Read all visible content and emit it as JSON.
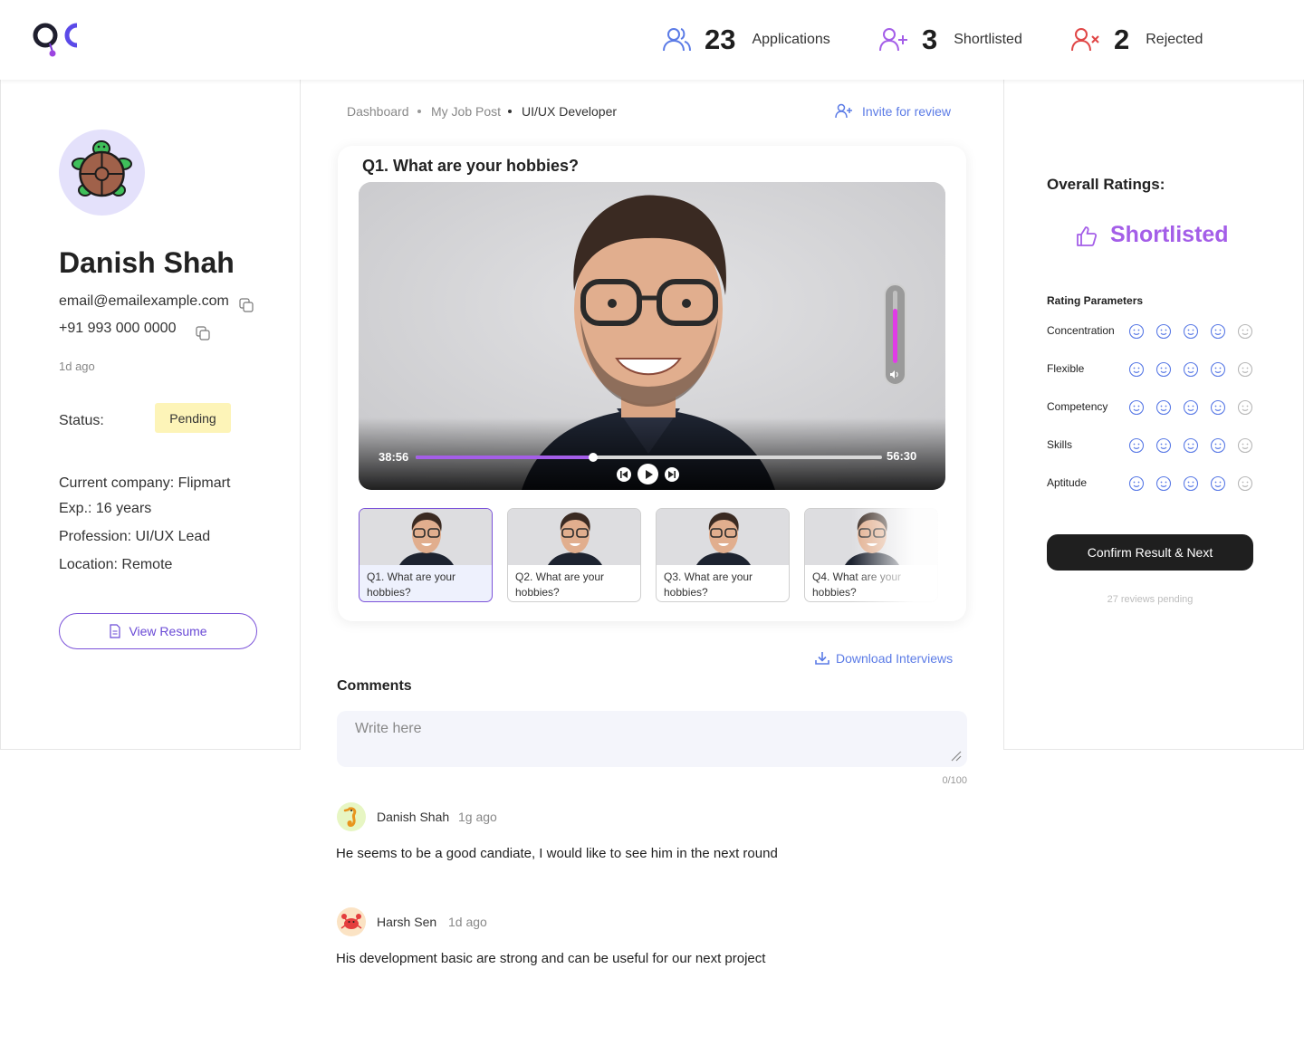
{
  "header": {
    "logo_text": "QC",
    "stats": [
      {
        "icon": "users-icon",
        "count": "23",
        "label": "Applications",
        "color": "#5b7be6"
      },
      {
        "icon": "user-plus-icon",
        "count": "3",
        "label": "Shortlisted",
        "color": "#a45ee8"
      },
      {
        "icon": "user-x-icon",
        "count": "2",
        "label": "Rejected",
        "color": "#e04646"
      }
    ]
  },
  "candidate": {
    "avatar_icon": "turtle-icon",
    "name": "Danish Shah",
    "email": "email@emailexample.com",
    "phone": "+91 993 000 0000",
    "time_ago": "1d ago",
    "status_label": "Status:",
    "status_value": "Pending",
    "status_color": "#fdf4b8",
    "current_company": "Current company: Flipmart",
    "experience": "Exp.: 16 years",
    "profession": "Profession: UI/UX Lead",
    "location": "Location: Remote",
    "view_resume": "View Resume"
  },
  "breadcrumb": {
    "items": [
      "Dashboard",
      "My Job Post",
      "UI/UX Developer"
    ],
    "invite": "Invite for review"
  },
  "video": {
    "question": "Q1. What are your hobbies?",
    "current_time": "38:56",
    "total_time": "56:30",
    "progress": 0.38,
    "volume": 0.75,
    "accent": "#a45ee8",
    "thumbnails": [
      {
        "caption": "Q1. What are your hobbies?",
        "selected": true
      },
      {
        "caption": "Q2. What are your hobbies?",
        "selected": false
      },
      {
        "caption": "Q3. What are your hobbies?",
        "selected": false
      },
      {
        "caption": "Q4. What are your hobbies?",
        "selected": false
      }
    ],
    "download": "Download Interviews"
  },
  "comments": {
    "title": "Comments",
    "placeholder": "Write here",
    "counter": "0/100",
    "items": [
      {
        "avatar_icon": "seahorse-icon",
        "name": "Danish Shah",
        "time": "1g ago",
        "text": "He seems to be a good candiate, I would like to see him in the next round"
      },
      {
        "avatar_icon": "crab-icon",
        "name": "Harsh Sen",
        "time": "1d ago",
        "text": "His development basic are strong and can be useful for our next project"
      }
    ]
  },
  "ratings": {
    "title": "Overall Ratings:",
    "result": "Shortlisted",
    "result_icon": "thumbs-up-icon",
    "params_title": "Rating Parameters",
    "params": [
      "Concentration",
      "Flexible",
      "Competency",
      "Skills",
      "Aptitude"
    ],
    "confirm": "Confirm Result & Next",
    "pending": "27 reviews pending"
  }
}
